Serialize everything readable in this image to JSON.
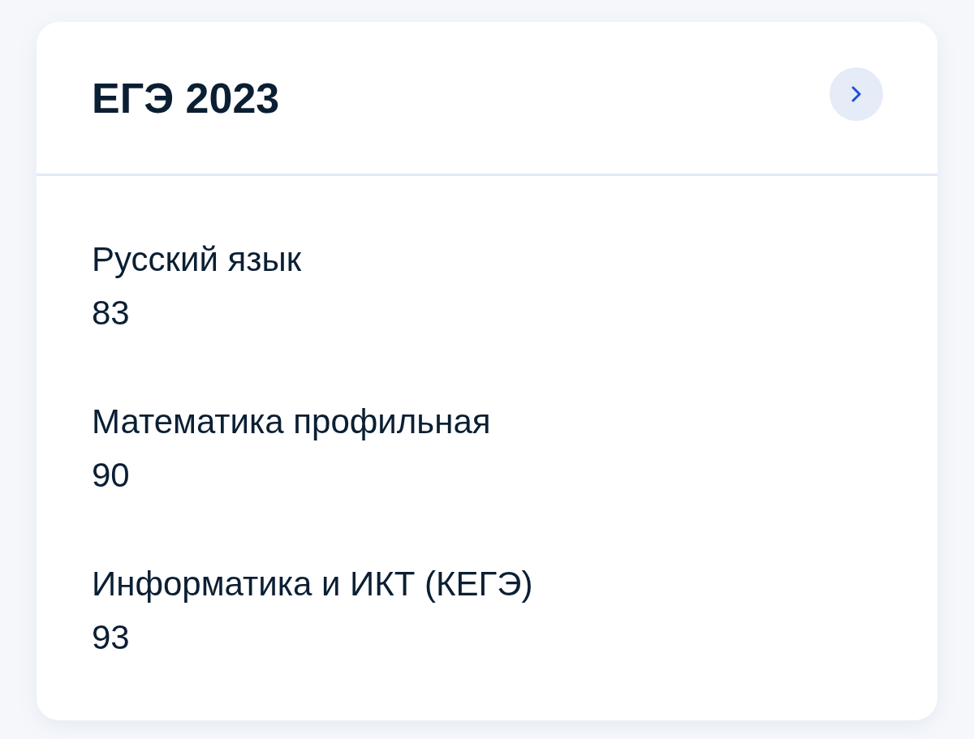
{
  "card": {
    "title": "ЕГЭ 2023",
    "results": [
      {
        "subject": "Русский язык",
        "score": "83"
      },
      {
        "subject": "Математика профильная",
        "score": "90"
      },
      {
        "subject": "Информатика и ИКТ (КЕГЭ)",
        "score": "93"
      }
    ]
  }
}
